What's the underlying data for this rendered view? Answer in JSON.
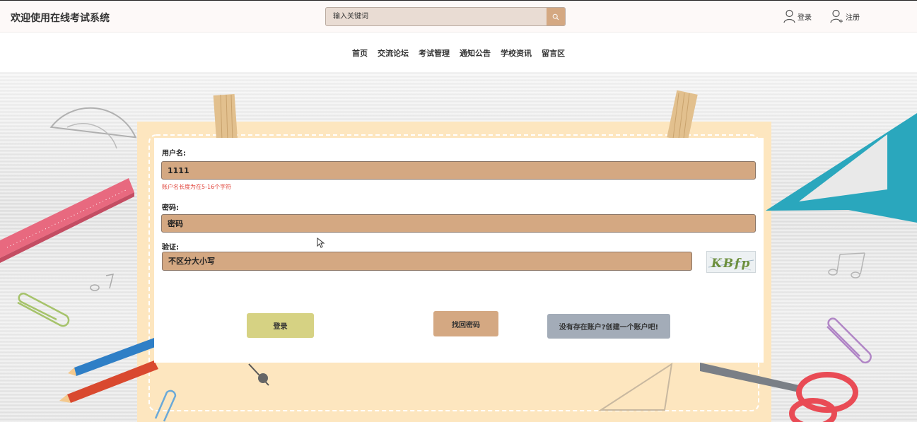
{
  "header": {
    "site_title": "欢迎使用在线考试系统",
    "search_placeholder": "输入关键词",
    "login_label": "登录",
    "register_label": "注册"
  },
  "nav": {
    "items": [
      "首页",
      "交流论坛",
      "考试管理",
      "通知公告",
      "学校资讯",
      "留言区"
    ]
  },
  "form": {
    "username_label": "用户名:",
    "username_value": "1111",
    "username_error": "账户名长度为在5-16个字符",
    "password_label": "密码:",
    "password_placeholder": "密码",
    "captcha_label": "验证:",
    "captcha_placeholder": "不区分大小写",
    "captcha_text": "KBfp",
    "login_button": "登录",
    "forgot_button": "找回密码",
    "create_account_button": "没有存在账户?创建一个账户吧!"
  },
  "colors": {
    "input_fill": "#d4a882",
    "login_button": "#d6d283",
    "create_button": "#a3acb8",
    "error": "#e0443b"
  },
  "icons": {
    "search": "search-icon",
    "login": "user-icon",
    "register": "user-add-icon"
  }
}
